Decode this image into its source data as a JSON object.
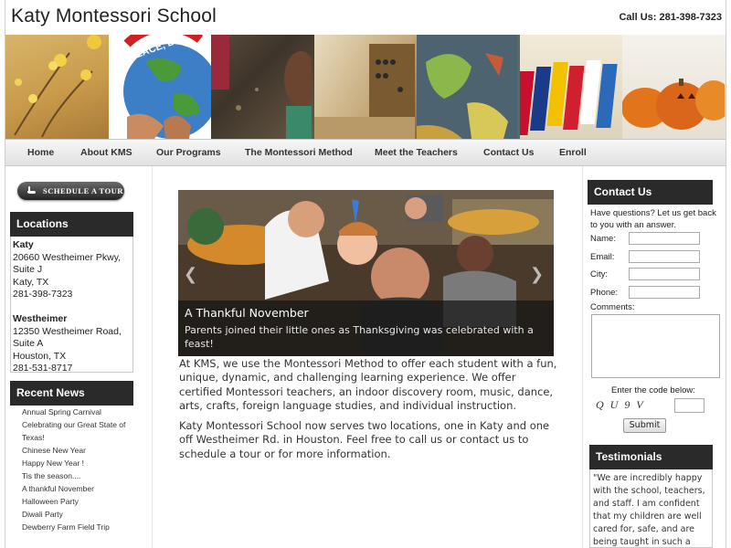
{
  "header": {
    "site_title": "Katy Montessori School",
    "phone": "Call Us: 281-398-7323"
  },
  "banner": {
    "peace_text": "PEACE, LO"
  },
  "nav": {
    "items": [
      {
        "label": "Home"
      },
      {
        "label": "About KMS"
      },
      {
        "label": "Our Programs"
      },
      {
        "label": "The Montessori Method"
      },
      {
        "label": "Meet the Teachers"
      },
      {
        "label": "Contact Us"
      },
      {
        "label": "Enroll"
      }
    ]
  },
  "sidebar": {
    "tour_button": "Schedule a Tour",
    "locations_title": "Locations",
    "katy": {
      "name": "Katy",
      "line1": "20660 Westheimer Pkwy,",
      "line2": "Suite J",
      "line3": "Katy,  TX",
      "phone": "281-398-7323"
    },
    "westheimer": {
      "name": "Westheimer",
      "line1": "12350 Westheimer Road,",
      "line2": "Suite A",
      "line3": "Houston,  TX",
      "phone": "281-531-8717"
    },
    "news_title": "Recent News",
    "news": [
      {
        "label": "Annual Spring Carnival"
      },
      {
        "label": "Celebrating our Great State of"
      },
      {
        "label": "Texas!"
      },
      {
        "label": "Chinese New Year"
      },
      {
        "label": "Happy New Year !"
      },
      {
        "label": "Tis the season...."
      },
      {
        "label": "A thankful November"
      },
      {
        "label": "Halloween Party"
      },
      {
        "label": "Diwali Party"
      },
      {
        "label": "Dewberry Farm Field Trip"
      }
    ]
  },
  "slider": {
    "title": "A Thankful November",
    "text": "Parents joined their little ones as Thanksgiving was celebrated with a feast!"
  },
  "main": {
    "paragraph1": "At KMS, we use the Montessori Method to offer each student with a fun, unique, dynamic, and challenging learning experience. We offer certified Montessori teachers, an indoor discovery room, music, dance, arts, crafts, foreign language studies, and individual instruction.",
    "paragraph2": "Katy Montessori School now serves two locations, one in Katy and one off Westheimer Rd. in Houston. Feel free to call us or contact us to schedule a tour or for more information."
  },
  "contact": {
    "title": "Contact Us",
    "intro": "Have questions? Let us get back to you with an answer.",
    "name_label": "Name:",
    "email_label": "Email:",
    "city_label": "City:",
    "phone_label": "Phone:",
    "comments_label": "Comments:",
    "code_label": "Enter the code below:",
    "captcha_text": "Q U 9  V",
    "submit_label": "Submit"
  },
  "testimonials": {
    "title": "Testimonials",
    "text": "\"We are incredibly happy with the school, teachers, and staff. I am confident that my children are well cared for, safe, and are being taught in such a way"
  }
}
